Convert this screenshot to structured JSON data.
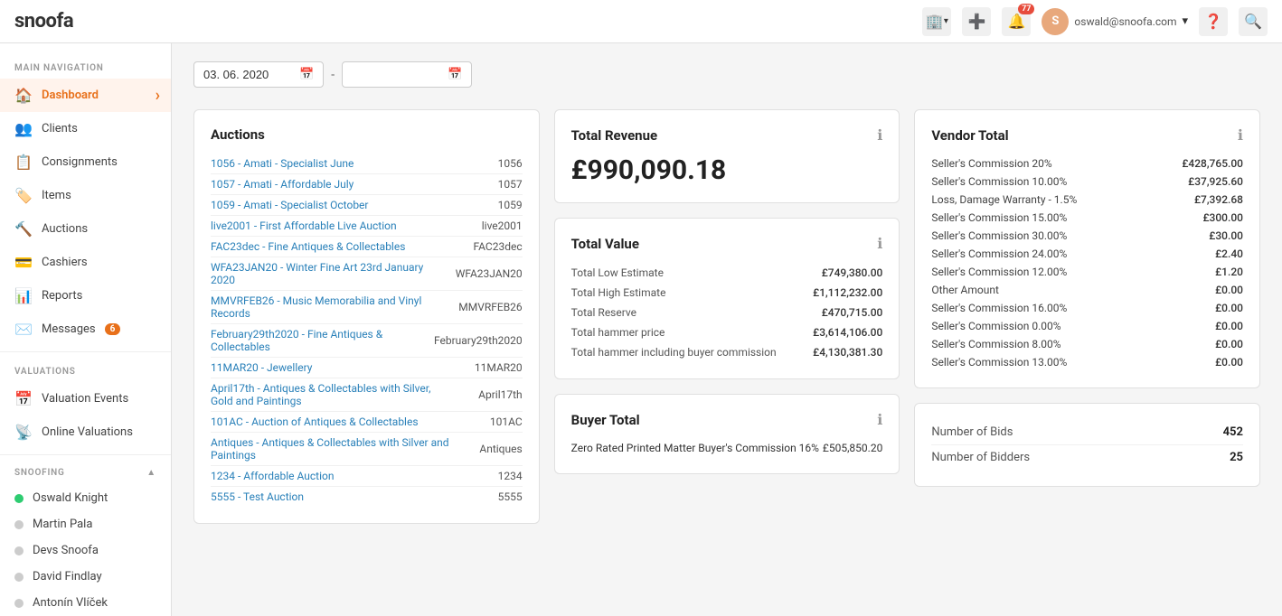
{
  "app": {
    "logo": "snoofa",
    "nav_icons": [
      "building-icon",
      "plus-icon",
      "bell-icon"
    ],
    "notification_count": "77",
    "user_initial": "S",
    "user_email": "oswald@snoofa.com",
    "help_icon": "?",
    "search_icon": "🔍"
  },
  "sidebar": {
    "main_nav_label": "MAIN NAVIGATION",
    "items": [
      {
        "id": "dashboard",
        "label": "Dashboard",
        "active": true,
        "icon": "🏠"
      },
      {
        "id": "clients",
        "label": "Clients",
        "active": false,
        "icon": "👥"
      },
      {
        "id": "consignments",
        "label": "Consignments",
        "active": false,
        "icon": "📋"
      },
      {
        "id": "items",
        "label": "Items",
        "active": false,
        "icon": "🏷️"
      },
      {
        "id": "auctions",
        "label": "Auctions",
        "active": false,
        "icon": "🔨"
      },
      {
        "id": "cashiers",
        "label": "Cashiers",
        "active": false,
        "icon": "💳"
      },
      {
        "id": "reports",
        "label": "Reports",
        "active": false,
        "icon": "📊"
      },
      {
        "id": "messages",
        "label": "Messages",
        "active": false,
        "icon": "✉️",
        "badge": "6"
      }
    ],
    "valuations_label": "VALUATIONS",
    "valuation_items": [
      {
        "id": "valuation-events",
        "label": "Valuation Events",
        "icon": "📅"
      },
      {
        "id": "online-valuations",
        "label": "Online Valuations",
        "icon": "📡"
      }
    ],
    "snoofing_label": "SNOOFING",
    "snoofing_items": [
      {
        "id": "oswald-knight",
        "label": "Oswald Knight",
        "color": "#2ecc71",
        "online": true
      },
      {
        "id": "martin-pala",
        "label": "Martin Pala",
        "color": "#ccc",
        "online": false
      },
      {
        "id": "devs-snoofa",
        "label": "Devs Snoofa",
        "color": "#ccc",
        "online": false
      },
      {
        "id": "david-findlay",
        "label": "David Findlay",
        "color": "#ccc",
        "online": false
      },
      {
        "id": "antonin-vlicek",
        "label": "Antonín Vlíček",
        "color": "#ccc",
        "online": false
      }
    ]
  },
  "date_filter": {
    "start_date": "03. 06. 2020",
    "end_date": "",
    "calendar_icon": "📅"
  },
  "auctions_card": {
    "title": "Auctions",
    "items": [
      {
        "label": "1056 - Amati - Specialist June",
        "code": "1056"
      },
      {
        "label": "1057 - Amati - Affordable July",
        "code": "1057"
      },
      {
        "label": "1059 - Amati - Specialist October",
        "code": "1059"
      },
      {
        "label": "live2001 - First Affordable Live Auction",
        "code": "live2001"
      },
      {
        "label": "FAC23dec - Fine Antiques & Collectables",
        "code": "FAC23dec"
      },
      {
        "label": "WFA23JAN20 - Winter Fine Art 23rd January 2020",
        "code": "WFA23JAN20"
      },
      {
        "label": "MMVRFEB26 - Music Memorabilia and Vinyl Records",
        "code": "MMVRFEB26"
      },
      {
        "label": "February29th2020 - Fine Antiques & Collectables",
        "code": "February29th2020"
      },
      {
        "label": "11MAR20 - Jewellery",
        "code": "11MAR20"
      },
      {
        "label": "April17th - Antiques & Collectables with Silver, Gold and Paintings",
        "code": "April17th"
      },
      {
        "label": "101AC - Auction of Antiques & Collectables",
        "code": "101AC"
      },
      {
        "label": "Antiques - Antiques & Collectables with Silver and Paintings",
        "code": "Antiques"
      },
      {
        "label": "1234 - Affordable Auction",
        "code": "1234"
      },
      {
        "label": "5555 - Test Auction",
        "code": "5555"
      }
    ]
  },
  "total_revenue_card": {
    "title": "Total Revenue",
    "amount": "£990,090.18"
  },
  "total_value_card": {
    "title": "Total Value",
    "rows": [
      {
        "label": "Total Low Estimate",
        "amount": "£749,380.00"
      },
      {
        "label": "Total High Estimate",
        "amount": "£1,112,232.00"
      },
      {
        "label": "Total Reserve",
        "amount": "£470,715.00"
      },
      {
        "label": "Total hammer price",
        "amount": "£3,614,106.00"
      },
      {
        "label": "Total hammer including buyer commission",
        "amount": "£4,130,381.30"
      }
    ]
  },
  "vendor_total_card": {
    "title": "Vendor Total",
    "rows": [
      {
        "label": "Seller's Commission 20%",
        "amount": "£428,765.00"
      },
      {
        "label": "Seller's Commission 10.00%",
        "amount": "£37,925.60"
      },
      {
        "label": "Loss, Damage Warranty - 1.5%",
        "amount": "£7,392.68"
      },
      {
        "label": "Seller's Commission 15.00%",
        "amount": "£300.00"
      },
      {
        "label": "Seller's Commission 30.00%",
        "amount": "£30.00"
      },
      {
        "label": "Seller's Commission 24.00%",
        "amount": "£2.40"
      },
      {
        "label": "Seller's Commission 12.00%",
        "amount": "£1.20"
      },
      {
        "label": "Other Amount",
        "amount": "£0.00"
      },
      {
        "label": "Seller's Commission 16.00%",
        "amount": "£0.00"
      },
      {
        "label": "Seller's Commission 0.00%",
        "amount": "£0.00"
      },
      {
        "label": "Seller's Commission 8.00%",
        "amount": "£0.00"
      },
      {
        "label": "Seller's Commission 13.00%",
        "amount": "£0.00"
      }
    ]
  },
  "buyer_total_card": {
    "title": "Buyer Total",
    "rows": [
      {
        "label": "Zero Rated Printed Matter Buyer's Commission 16%",
        "amount": "£505,850.20"
      }
    ]
  },
  "stats_card": {
    "rows": [
      {
        "label": "Number of Bids",
        "value": "452"
      },
      {
        "label": "Number of Bidders",
        "value": "25"
      }
    ]
  }
}
